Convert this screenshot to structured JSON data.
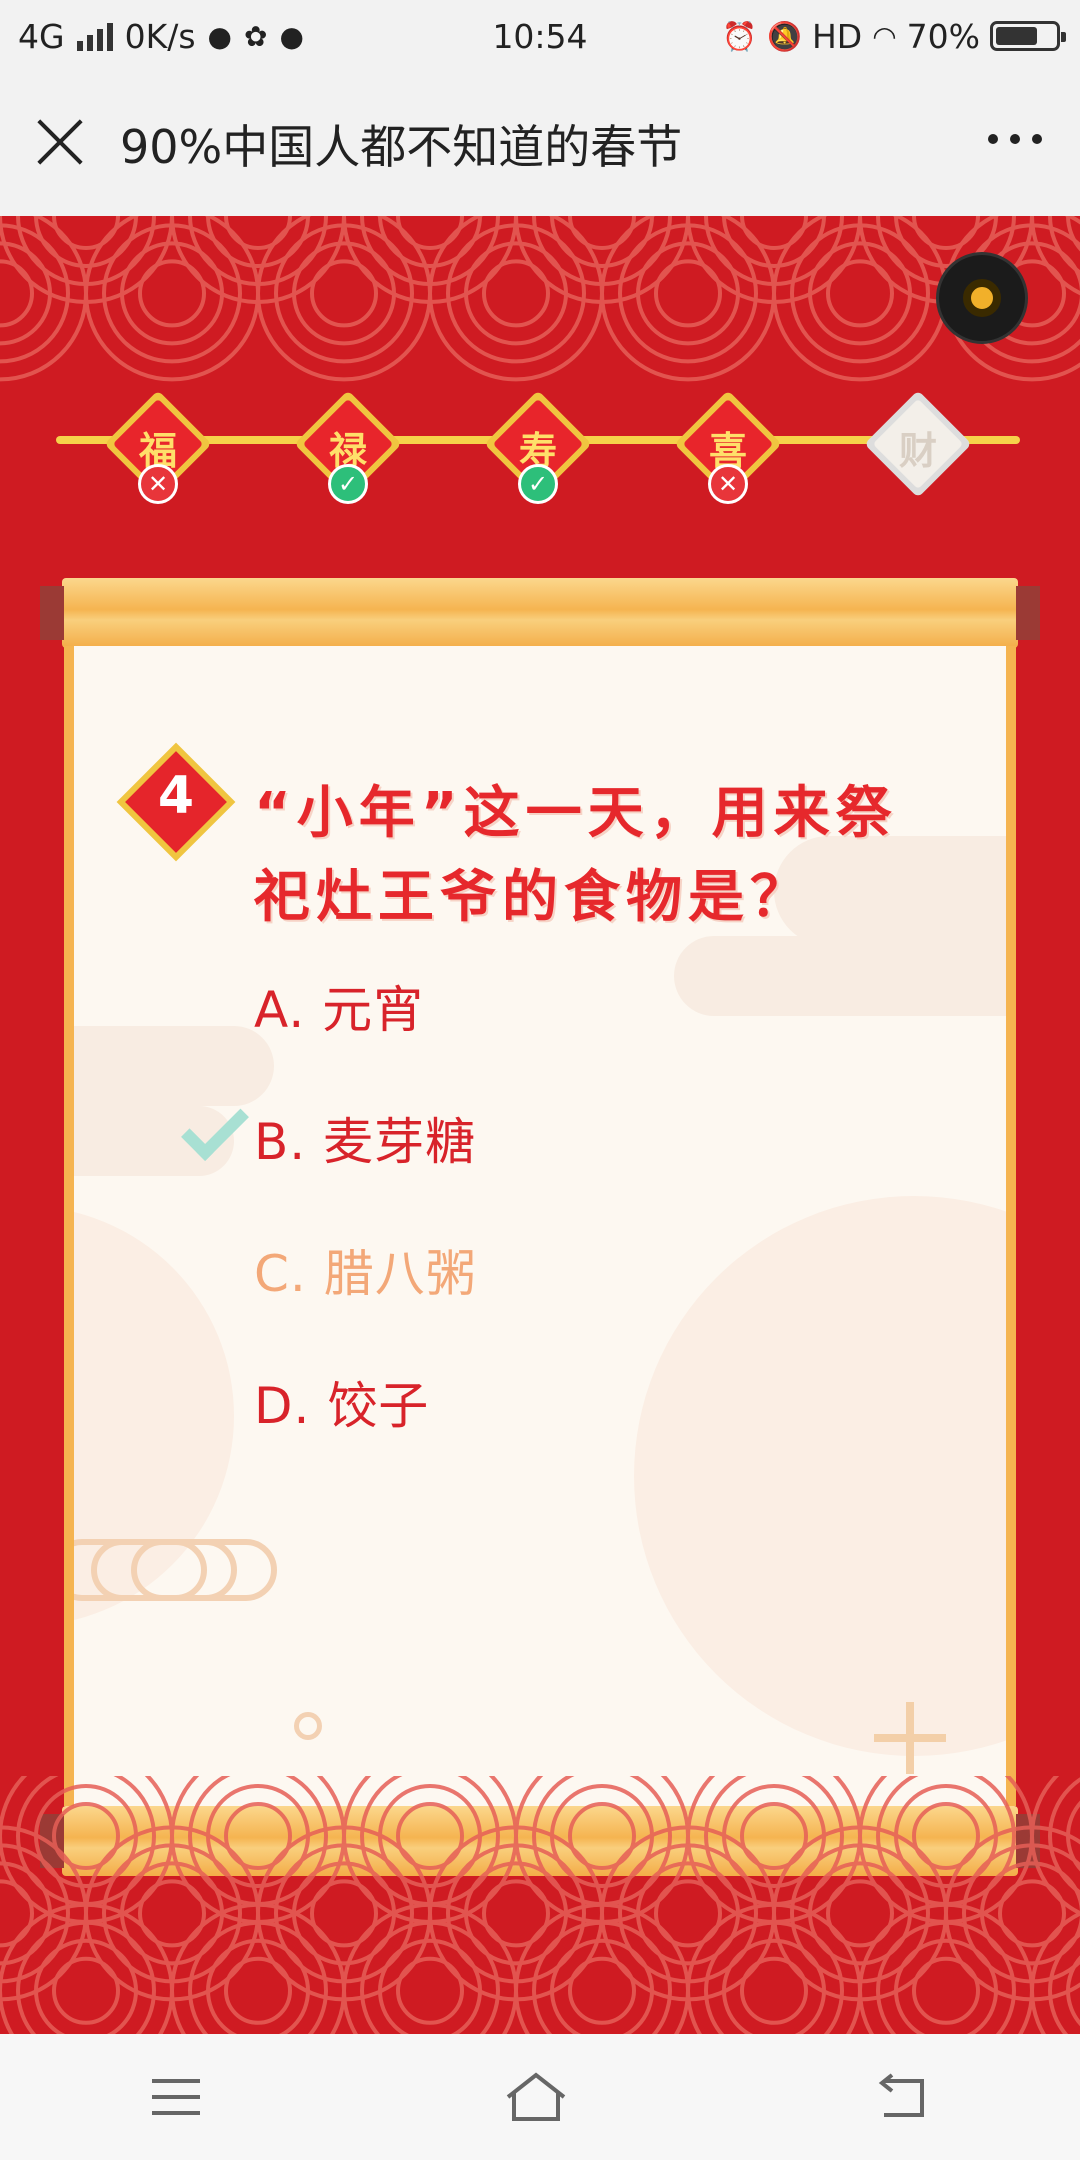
{
  "status_bar": {
    "network": "4G",
    "speed": "0K/s",
    "time": "10:54",
    "hd": "HD",
    "battery": "70%",
    "battery_level": 0.7
  },
  "titlebar": {
    "title": "90%中国人都不知道的春节"
  },
  "progress": {
    "stages": [
      {
        "char": "福",
        "state": "wrong"
      },
      {
        "char": "禄",
        "state": "right"
      },
      {
        "char": "寿",
        "state": "right"
      },
      {
        "char": "喜",
        "state": "wrong"
      },
      {
        "char": "财",
        "state": "pending"
      }
    ]
  },
  "quiz": {
    "number": "4",
    "question": "“小年”这一天，用来祭祀灶王爷的食物是？",
    "options": [
      {
        "label": "A. 元宵",
        "state": "normal"
      },
      {
        "label": "B. 麦芽糖",
        "state": "correct"
      },
      {
        "label": "C. 腊八粥",
        "state": "dimmed"
      },
      {
        "label": "D. 饺子",
        "state": "normal"
      }
    ]
  },
  "colors": {
    "background": "#cf1b22",
    "accent_gold": "#f5b450",
    "option_text": "#d8232a",
    "option_dimmed": "#f3a878",
    "correct_check": "#a8e0d3"
  }
}
